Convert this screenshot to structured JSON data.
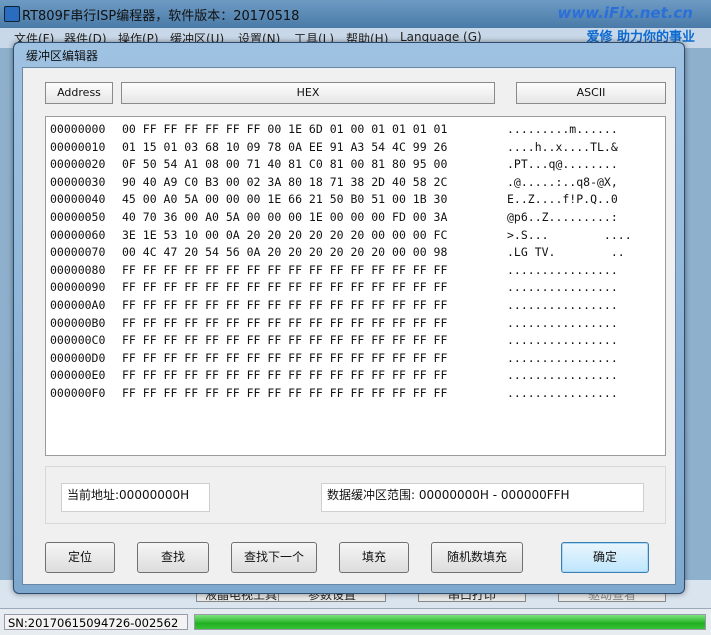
{
  "main_window": {
    "title": "RT809F串行ISP编程器，软件版本：20170518",
    "brand_url": "www.iFix.net.cn",
    "brand_slogan": "爱修  助力你的事业",
    "menu": [
      "文件(F)",
      "器件(D)",
      "操作(P)",
      "缓冲区(U)",
      "设置(N)",
      "工具(L)",
      "帮助(H)",
      "Language (G)"
    ],
    "bottom_buttons": [
      "液晶电视工具",
      "参数设置",
      "串口打印",
      "驱动查看"
    ]
  },
  "statusbar": {
    "sn": "SN:20170615094726-002562",
    "progress_percent": 100,
    "progress_color": "#22b022"
  },
  "dialog": {
    "title": "缓冲区编辑器",
    "headers": {
      "address": "Address",
      "hex": "HEX",
      "ascii": "ASCII"
    },
    "rows": [
      {
        "addr": "00000000",
        "hex": "00 FF FF FF FF FF FF 00 1E 6D 01 00 01 01 01 01",
        "ascii": ".........m......"
      },
      {
        "addr": "00000010",
        "hex": "01 15 01 03 68 10 09 78 0A EE 91 A3 54 4C 99 26",
        "ascii": "....h..x....TL.&"
      },
      {
        "addr": "00000020",
        "hex": "0F 50 54 A1 08 00 71 40 81 C0 81 00 81 80 95 00",
        "ascii": ".PT...q@........"
      },
      {
        "addr": "00000030",
        "hex": "90 40 A9 C0 B3 00 02 3A 80 18 71 38 2D 40 58 2C",
        "ascii": ".@.....:..q8-@X,"
      },
      {
        "addr": "00000040",
        "hex": "45 00 A0 5A 00 00 00 1E 66 21 50 B0 51 00 1B 30",
        "ascii": "E..Z....f!P.Q..0"
      },
      {
        "addr": "00000050",
        "hex": "40 70 36 00 A0 5A 00 00 00 1E 00 00 00 FD 00 3A",
        "ascii": "@p6..Z.........:"
      },
      {
        "addr": "00000060",
        "hex": "3E 1E 53 10 00 0A 20 20 20 20 20 20 00 00 00 FC",
        "ascii": ">.S...        ...."
      },
      {
        "addr": "00000070",
        "hex": "00 4C 47 20 54 56 0A 20 20 20 20 20 20 00 00 98",
        "ascii": ".LG TV.        .."
      },
      {
        "addr": "00000080",
        "hex": "FF FF FF FF FF FF FF FF FF FF FF FF FF FF FF FF",
        "ascii": "................"
      },
      {
        "addr": "00000090",
        "hex": "FF FF FF FF FF FF FF FF FF FF FF FF FF FF FF FF",
        "ascii": "................"
      },
      {
        "addr": "000000A0",
        "hex": "FF FF FF FF FF FF FF FF FF FF FF FF FF FF FF FF",
        "ascii": "................"
      },
      {
        "addr": "000000B0",
        "hex": "FF FF FF FF FF FF FF FF FF FF FF FF FF FF FF FF",
        "ascii": "................"
      },
      {
        "addr": "000000C0",
        "hex": "FF FF FF FF FF FF FF FF FF FF FF FF FF FF FF FF",
        "ascii": "................"
      },
      {
        "addr": "000000D0",
        "hex": "FF FF FF FF FF FF FF FF FF FF FF FF FF FF FF FF",
        "ascii": "................"
      },
      {
        "addr": "000000E0",
        "hex": "FF FF FF FF FF FF FF FF FF FF FF FF FF FF FF FF",
        "ascii": "................"
      },
      {
        "addr": "000000F0",
        "hex": "FF FF FF FF FF FF FF FF FF FF FF FF FF FF FF FF",
        "ascii": "................"
      }
    ],
    "current_address": "当前地址:00000000H",
    "buffer_range": "数据缓冲区范围: 00000000H - 000000FFH",
    "buttons": {
      "locate": "定位",
      "find": "查找",
      "find_next": "查找下一个",
      "fill": "填充",
      "random_fill": "随机数填充",
      "ok": "确定"
    }
  }
}
